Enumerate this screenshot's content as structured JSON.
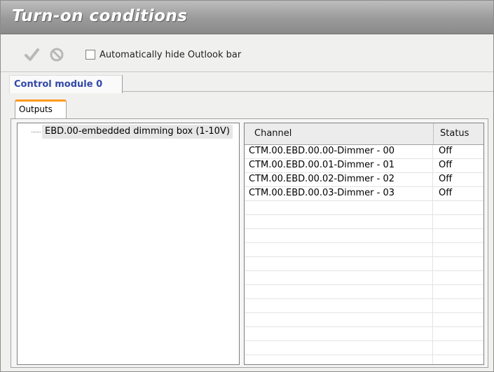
{
  "window": {
    "title": "Turn-on conditions"
  },
  "toolbar": {
    "confirm_icon": "checkmark-icon",
    "cancel_icon": "cancel-circle-icon",
    "auto_hide_label": "Automatically hide Outlook bar",
    "auto_hide_checked": false
  },
  "module_tab": {
    "label": "Control module 0"
  },
  "inner_tab": {
    "label": "Outputs"
  },
  "tree": {
    "node": "EBD.00-embedded dimming box (1-10V)"
  },
  "grid": {
    "columns": [
      "Channel",
      "Status"
    ],
    "rows": [
      {
        "channel": "CTM.00.EBD.00.00-Dimmer - 00",
        "status": "Off"
      },
      {
        "channel": "CTM.00.EBD.00.01-Dimmer - 01",
        "status": "Off"
      },
      {
        "channel": "CTM.00.EBD.00.02-Dimmer - 02",
        "status": "Off"
      },
      {
        "channel": "CTM.00.EBD.00.03-Dimmer - 03",
        "status": "Off"
      }
    ]
  },
  "colors": {
    "title_bar": "#9a9a9a",
    "tab_accent": "#ff9a1e",
    "module_tab_text": "#3247a8"
  }
}
